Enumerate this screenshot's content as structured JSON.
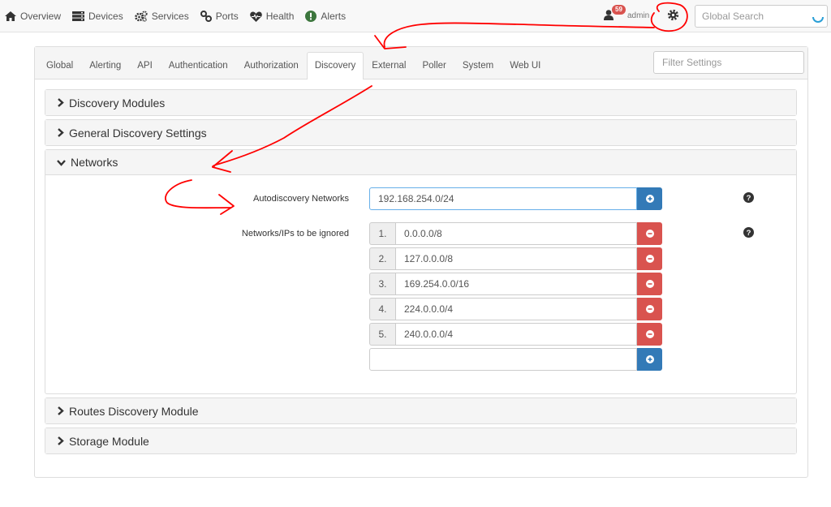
{
  "navbar": {
    "items": [
      {
        "label": "Overview",
        "icon": "home-icon"
      },
      {
        "label": "Devices",
        "icon": "server-icon"
      },
      {
        "label": "Services",
        "icon": "cogs-icon"
      },
      {
        "label": "Ports",
        "icon": "link-icon"
      },
      {
        "label": "Health",
        "icon": "heartbeat-icon"
      },
      {
        "label": "Alerts",
        "icon": "exclamation-circle-icon"
      }
    ],
    "notification_count": "59",
    "user_name": "admin",
    "global_search_placeholder": "Global Search"
  },
  "settings": {
    "tabs": [
      "Global",
      "Alerting",
      "API",
      "Authentication",
      "Authorization",
      "Discovery",
      "External",
      "Poller",
      "System",
      "Web UI"
    ],
    "active_tab": "Discovery",
    "filter_placeholder": "Filter Settings",
    "sections": {
      "discovery_modules": "Discovery Modules",
      "general_discovery": "General Discovery Settings",
      "networks": "Networks",
      "routes_discovery": "Routes Discovery Module",
      "storage_module": "Storage Module"
    },
    "networks": {
      "autodiscovery_label": "Autodiscovery Networks",
      "autodiscovery_value": "192.168.254.0/24",
      "ignored_label": "Networks/IPs to be ignored",
      "ignored": [
        {
          "index": "1.",
          "value": "0.0.0.0/8"
        },
        {
          "index": "2.",
          "value": "127.0.0.0/8"
        },
        {
          "index": "3.",
          "value": "169.254.0.0/16"
        },
        {
          "index": "4.",
          "value": "224.0.0.0/4"
        },
        {
          "index": "5.",
          "value": "240.0.0.0/4"
        }
      ],
      "new_value": ""
    }
  },
  "colors": {
    "primary": "#337ab7",
    "danger": "#d9534f",
    "annotation": "#ff0000"
  }
}
